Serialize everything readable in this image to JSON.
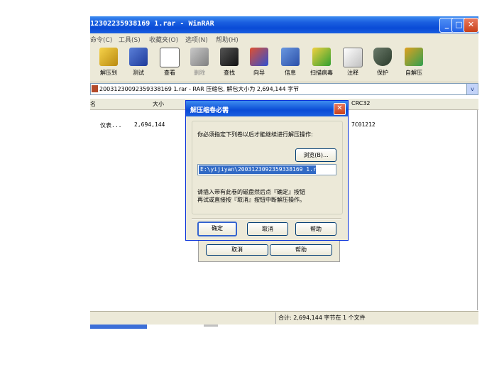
{
  "window": {
    "title": "12302235938169 1.rar - WinRAR",
    "minimize": "_",
    "maximize": "□",
    "close": "✕"
  },
  "menu": [
    {
      "label": "命令(C)"
    },
    {
      "label": "工具(S)"
    },
    {
      "label": "收藏夹(O)"
    },
    {
      "label": "选项(N)"
    },
    {
      "label": "帮助(H)"
    }
  ],
  "toolbar": [
    {
      "label": "解压到",
      "icon": "extract-to-icon"
    },
    {
      "label": "测试",
      "icon": "test-icon"
    },
    {
      "label": "查看",
      "icon": "view-icon"
    },
    {
      "label": "删除",
      "icon": "delete-icon"
    },
    {
      "label": "查找",
      "icon": "find-icon"
    },
    {
      "label": "向导",
      "icon": "wizard-icon"
    },
    {
      "label": "信息",
      "icon": "info-icon"
    },
    {
      "label": "扫描病毒",
      "icon": "virus-scan-icon"
    },
    {
      "label": "注释",
      "icon": "comment-icon"
    },
    {
      "label": "保护",
      "icon": "protect-icon"
    },
    {
      "label": "自解压",
      "icon": "sfx-icon"
    }
  ],
  "address": {
    "text": "20031230092359338169 1.rar - RAR 压缩包, 解包大小为 2,694,144 字节",
    "dropdown": "v"
  },
  "columns": {
    "name": "名",
    "size": "大小",
    "crc": "CRC32"
  },
  "file_row": {
    "name": "仪表...",
    "size": "2,694,144",
    "crc": "7C01212"
  },
  "status": {
    "text": "合计: 2,694,144 字节在 1 个文件"
  },
  "dialog": {
    "title": "解压缩卷必需",
    "close": "✕",
    "prompt": "你必须指定下列卷以后才能继续进行解压操作:",
    "browse": "浏览(B)...",
    "path": "E:\\yijiyan\\2003123092359338169 1.rar",
    "instructions_line1": "请插入带有此卷的磁盘然后点『确定』按钮",
    "instructions_line2": "再试或直接按『取消』按钮中断解压操作。",
    "ok": "确定",
    "cancel": "取消",
    "help": "帮助"
  },
  "dialog2": {
    "cancel": "取消",
    "help": "帮助"
  },
  "colors": {
    "title_blue": "#0a4bd6",
    "xp_face": "#ece9d8",
    "selection": "#316ac5"
  }
}
